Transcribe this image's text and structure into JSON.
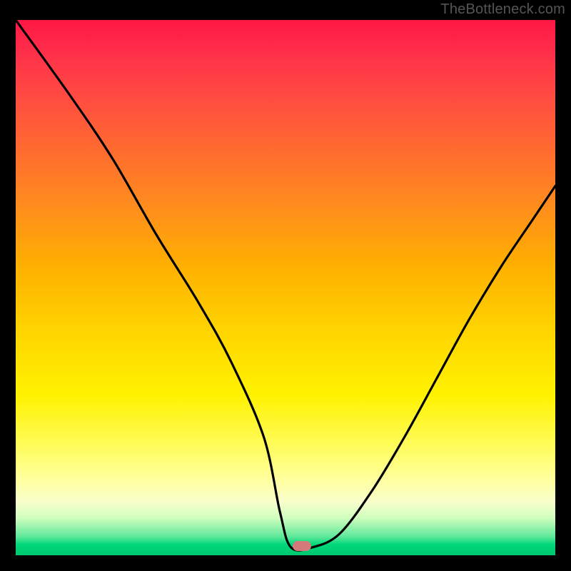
{
  "watermark": "TheBottleneck.com",
  "marker": {
    "x_pct": 53.0,
    "y_pct": 98.2
  },
  "chart_data": {
    "type": "line",
    "title": "",
    "xlabel": "",
    "ylabel": "",
    "xlim": [
      0,
      100
    ],
    "ylim": [
      0,
      100
    ],
    "series": [
      {
        "name": "bottleneck-curve",
        "x": [
          0,
          10,
          18,
          26,
          34,
          40,
          46,
          49,
          51,
          55,
          60,
          66,
          72,
          78,
          84,
          90,
          96,
          100
        ],
        "values": [
          100,
          86,
          74,
          60,
          47,
          36,
          22,
          8,
          1.5,
          1.5,
          4,
          12,
          22,
          33,
          44,
          54,
          63,
          69
        ]
      }
    ],
    "background_gradient": {
      "top": "#ff1744",
      "mid": "#ffd400",
      "bottom": "#00c86e"
    },
    "marker_point": {
      "x": 53,
      "y": 1.8
    }
  }
}
